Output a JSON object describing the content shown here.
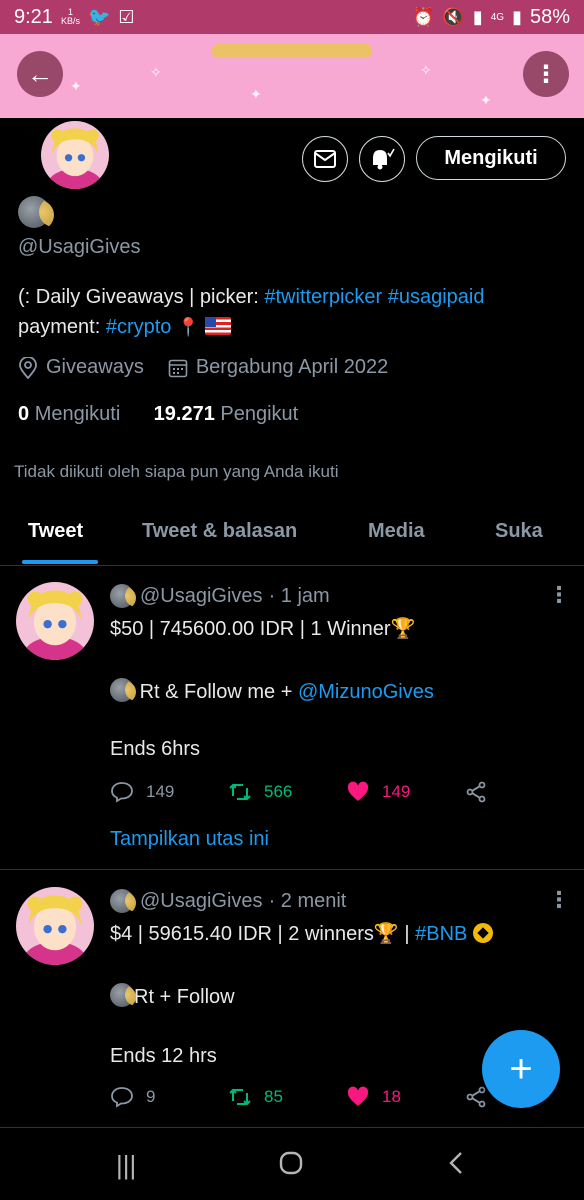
{
  "status_bar": {
    "time": "9:21",
    "kbs_value": "1",
    "kbs_unit": "KB/s",
    "signal_label": "4G",
    "battery": "58%"
  },
  "profile": {
    "handle": "@UsagiGives",
    "bio_prefix": "(: Daily Giveaways | picker: ",
    "bio_tag1": "#twitterpicker",
    "bio_tag2": "#usagipaid",
    "bio_payment": "payment: ",
    "bio_tag3": "#crypto",
    "location": "Giveaways",
    "joined": "Bergabung April 2022",
    "following_count": "0",
    "following_label": "Mengikuti",
    "followers_count": "19.271",
    "followers_label": "Pengikut",
    "not_followed_text": "Tidak diikuti oleh siapa pun yang Anda ikuti",
    "follow_button": "Mengikuti"
  },
  "tabs": [
    {
      "label": "Tweet",
      "active": true
    },
    {
      "label": "Tweet & balasan",
      "active": false
    },
    {
      "label": "Media",
      "active": false
    },
    {
      "label": "Suka",
      "active": false
    }
  ],
  "tweets": [
    {
      "handle": "@UsagiGives",
      "time": "· 1 jam",
      "line1": "$50 | 745600.00 IDR | 1 Winner",
      "line2_prefix": "Rt & Follow me + ",
      "line2_mention": "@MizunoGives",
      "line3": "Ends 6hrs",
      "replies": "149",
      "retweets": "566",
      "likes": "149",
      "show_thread": "Tampilkan utas ini"
    },
    {
      "handle": "@UsagiGives",
      "time": "· 2 menit",
      "line1": "$4 | 59615.40 IDR | 2 winners",
      "line1_sep": " | ",
      "line1_tag": "#BNB",
      "line2_prefix": "Rt + Follow",
      "line3": "Ends 12 hrs",
      "replies": "9",
      "retweets": "85",
      "likes": "18"
    }
  ],
  "colors": {
    "accent": "#1d9bf0",
    "retweet": "#00ba7c",
    "like": "#f91880",
    "status_bar": "#b03a6a",
    "banner": "#f7a9d4"
  },
  "icons": {
    "back": "arrow-left-icon",
    "more": "more-vertical-icon",
    "message": "envelope-icon",
    "notify": "bell-icon",
    "location": "location-pin-icon",
    "calendar": "calendar-icon",
    "reply": "reply-icon",
    "retweet": "retweet-icon",
    "like": "heart-icon",
    "share": "share-icon",
    "compose": "plus-icon"
  }
}
